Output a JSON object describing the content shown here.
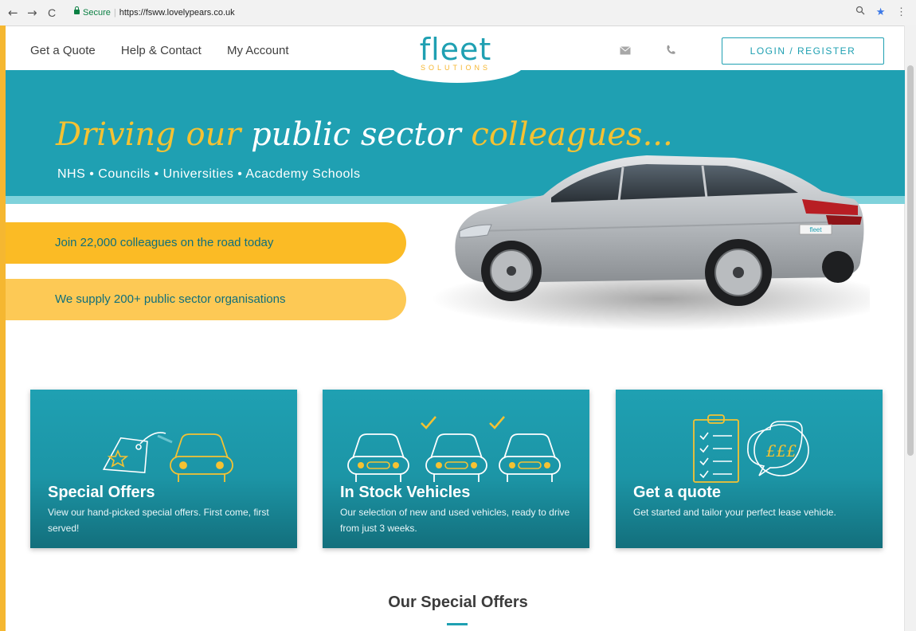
{
  "browser": {
    "back": "←",
    "forward": "→",
    "reload": "C",
    "secure_label": "Secure",
    "url": "https://fsww.lovelypears.co.uk"
  },
  "header": {
    "nav": [
      "Get a Quote",
      "Help & Contact",
      "My Account"
    ],
    "logo_main": "fleet",
    "logo_sub": "SOLUTIONS",
    "login_label": "LOGIN / REGISTER"
  },
  "hero": {
    "tagline_part1": "Driving our ",
    "tagline_part2": "public sector",
    "tagline_part3": " colleagues...",
    "sectors": "NHS • Councils • Universities • Acacdemy Schools",
    "pill1": "Join 22,000 colleagues on the road today",
    "pill2": "We supply 200+ public sector organisations",
    "plate": "fleet"
  },
  "cards": [
    {
      "title": "Special Offers",
      "desc": "View our hand-picked special offers. First come, first served!"
    },
    {
      "title": "In Stock Vehicles",
      "desc": "Our selection of new and used vehicles, ready to drive from just 3 weeks."
    },
    {
      "title": "Get a quote",
      "desc": "Get started and tailor your perfect lease vehicle."
    }
  ],
  "quote_icon_text": "£££",
  "section_title": "Our Special Offers",
  "colors": {
    "teal": "#1fa0b2",
    "yellow": "#f5b731"
  }
}
